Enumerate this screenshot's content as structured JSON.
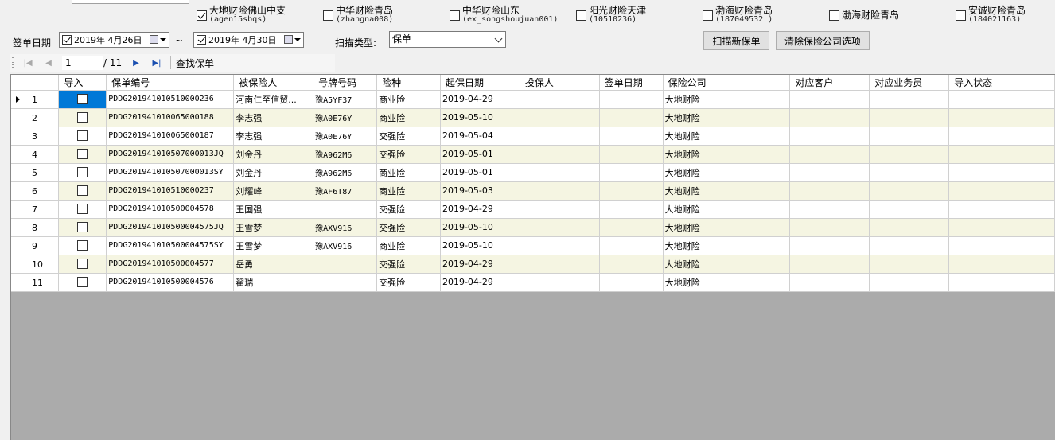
{
  "companies": [
    {
      "name": "大地财险佛山中支",
      "code": "(agen15sbqs)",
      "checked": true
    },
    {
      "name": "中华财险青岛",
      "code": "(zhangna008)",
      "checked": false
    },
    {
      "name": "中华财险山东",
      "code": "(ex_songshoujuan001)",
      "checked": false
    },
    {
      "name": "阳光财险天津",
      "code": "(10510236)",
      "checked": false
    },
    {
      "name": "渤海财险青岛",
      "code": "(187049532 )",
      "checked": false
    },
    {
      "name": "渤海财险青岛",
      "code": "",
      "checked": false
    },
    {
      "name": "安诚财险青岛",
      "code": "(184021163)",
      "checked": false
    }
  ],
  "filters": {
    "sign_date_label": "签单日期",
    "date_from": "2019年  4月26日",
    "date_to": "2019年  4月30日",
    "tilde": "~",
    "scan_type_label": "扫描类型:",
    "scan_type_value": "保单"
  },
  "buttons": {
    "scan_new": "扫描新保单",
    "clear_options": "清除保险公司选项"
  },
  "navigator": {
    "position": "1",
    "total": "/ 11",
    "find": "查找保单"
  },
  "table": {
    "columns": [
      "导入",
      "保单编号",
      "被保险人",
      "号牌号码",
      "险种",
      "起保日期",
      "投保人",
      "签单日期",
      "保险公司",
      "对应客户",
      "对应业务员",
      "导入状态"
    ],
    "rows": [
      {
        "num": "1",
        "policy": "PDDG201941010510000236",
        "insured": "河南仁至信贸...",
        "plate": "豫A5YF37",
        "type": "商业险",
        "start": "2019-04-29",
        "applicant": "",
        "sign": "",
        "company": "大地财险",
        "customer": "",
        "salesman": "",
        "status": ""
      },
      {
        "num": "2",
        "policy": "PDDG201941010065000188",
        "insured": "李志强",
        "plate": "豫A0E76Y",
        "type": "商业险",
        "start": "2019-05-10",
        "applicant": "",
        "sign": "",
        "company": "大地财险",
        "customer": "",
        "salesman": "",
        "status": ""
      },
      {
        "num": "3",
        "policy": "PDDG201941010065000187",
        "insured": "李志强",
        "plate": "豫A0E76Y",
        "type": "交强险",
        "start": "2019-05-04",
        "applicant": "",
        "sign": "",
        "company": "大地财险",
        "customer": "",
        "salesman": "",
        "status": ""
      },
      {
        "num": "4",
        "policy": "PDDG201941010507000013JQ",
        "insured": "刘金丹",
        "plate": "豫A962M6",
        "type": "交强险",
        "start": "2019-05-01",
        "applicant": "",
        "sign": "",
        "company": "大地财险",
        "customer": "",
        "salesman": "",
        "status": ""
      },
      {
        "num": "5",
        "policy": "PDDG201941010507000013SY",
        "insured": "刘金丹",
        "plate": "豫A962M6",
        "type": "商业险",
        "start": "2019-05-01",
        "applicant": "",
        "sign": "",
        "company": "大地财险",
        "customer": "",
        "salesman": "",
        "status": ""
      },
      {
        "num": "6",
        "policy": "PDDG201941010510000237",
        "insured": "刘耀峰",
        "plate": "豫AF6T87",
        "type": "商业险",
        "start": "2019-05-03",
        "applicant": "",
        "sign": "",
        "company": "大地财险",
        "customer": "",
        "salesman": "",
        "status": ""
      },
      {
        "num": "7",
        "policy": "PDDG201941010500004578",
        "insured": "王国强",
        "plate": "",
        "type": "交强险",
        "start": "2019-04-29",
        "applicant": "",
        "sign": "",
        "company": "大地财险",
        "customer": "",
        "salesman": "",
        "status": ""
      },
      {
        "num": "8",
        "policy": "PDDG201941010500004575JQ",
        "insured": "王雪梦",
        "plate": "豫AXV916",
        "type": "交强险",
        "start": "2019-05-10",
        "applicant": "",
        "sign": "",
        "company": "大地财险",
        "customer": "",
        "salesman": "",
        "status": ""
      },
      {
        "num": "9",
        "policy": "PDDG201941010500004575SY",
        "insured": "王雪梦",
        "plate": "豫AXV916",
        "type": "商业险",
        "start": "2019-05-10",
        "applicant": "",
        "sign": "",
        "company": "大地财险",
        "customer": "",
        "salesman": "",
        "status": ""
      },
      {
        "num": "10",
        "policy": "PDDG201941010500004577",
        "insured": "岳勇",
        "plate": "",
        "type": "交强险",
        "start": "2019-04-29",
        "applicant": "",
        "sign": "",
        "company": "大地财险",
        "customer": "",
        "salesman": "",
        "status": ""
      },
      {
        "num": "11",
        "policy": "PDDG201941010500004576",
        "insured": "翟瑞",
        "plate": "",
        "type": "交强险",
        "start": "2019-04-29",
        "applicant": "",
        "sign": "",
        "company": "大地财险",
        "customer": "",
        "salesman": "",
        "status": ""
      }
    ]
  }
}
